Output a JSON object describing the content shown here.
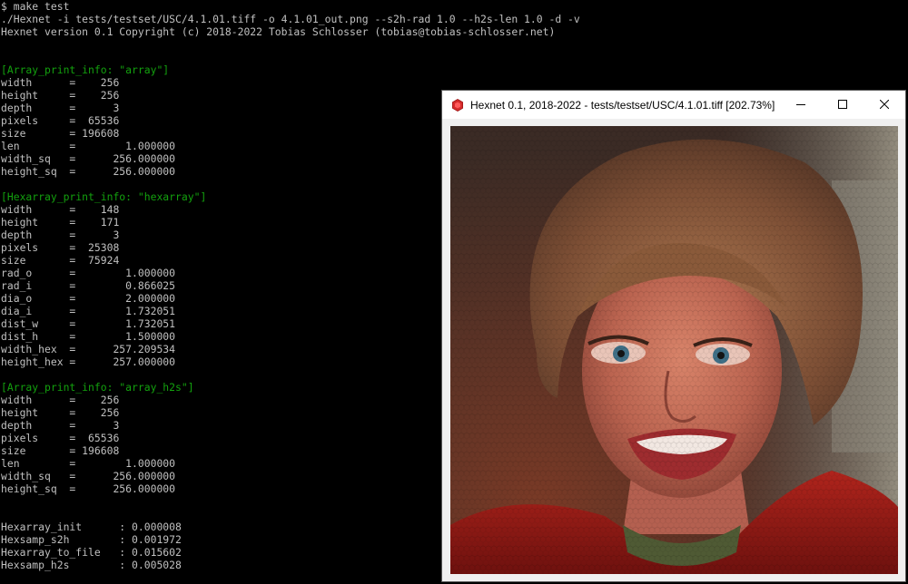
{
  "terminal": {
    "lines": [
      "$ make test",
      "./Hexnet -i tests/testset/USC/4.1.01.tiff -o 4.1.01_out.png --s2h-rad 1.0 --h2s-len 1.0 -d -v",
      "Hexnet version 0.1 Copyright (c) 2018-2022 Tobias Schlosser (tobias@tobias-schlosser.net)",
      "",
      "",
      "[Array_print_info: \"array\"]",
      "width      =    256",
      "height     =    256",
      "depth      =      3",
      "pixels     =  65536",
      "size       = 196608",
      "len        =        1.000000",
      "width_sq   =      256.000000",
      "height_sq  =      256.000000",
      "",
      "[Hexarray_print_info: \"hexarray\"]",
      "width      =    148",
      "height     =    171",
      "depth      =      3",
      "pixels     =  25308",
      "size       =  75924",
      "rad_o      =        1.000000",
      "rad_i      =        0.866025",
      "dia_o      =        2.000000",
      "dia_i      =        1.732051",
      "dist_w     =        1.732051",
      "dist_h     =        1.500000",
      "width_hex  =      257.209534",
      "height_hex =      257.000000",
      "",
      "[Array_print_info: \"array_h2s\"]",
      "width      =    256",
      "height     =    256",
      "depth      =      3",
      "pixels     =  65536",
      "size       = 196608",
      "len        =        1.000000",
      "width_sq   =      256.000000",
      "height_sq  =      256.000000",
      "",
      "",
      "Hexarray_init      : 0.000008",
      "Hexsamp_s2h        : 0.001972",
      "Hexarray_to_file   : 0.015602",
      "Hexsamp_h2s        : 0.005028"
    ],
    "header_lines": [
      5,
      15,
      30
    ],
    "text_color": "#c0c0c0",
    "header_color": "#13a10e"
  },
  "viewer": {
    "title": "Hexnet 0.1, 2018-2022 - tests/testset/USC/4.1.01.tiff [202.73%]",
    "app_icon": "hexnet-app-icon",
    "minimize_icon": "minimize-icon",
    "maximize_icon": "maximize-icon",
    "close_icon": "close-icon",
    "image_description_icon": "hexagonal-sampled-portrait-image"
  }
}
